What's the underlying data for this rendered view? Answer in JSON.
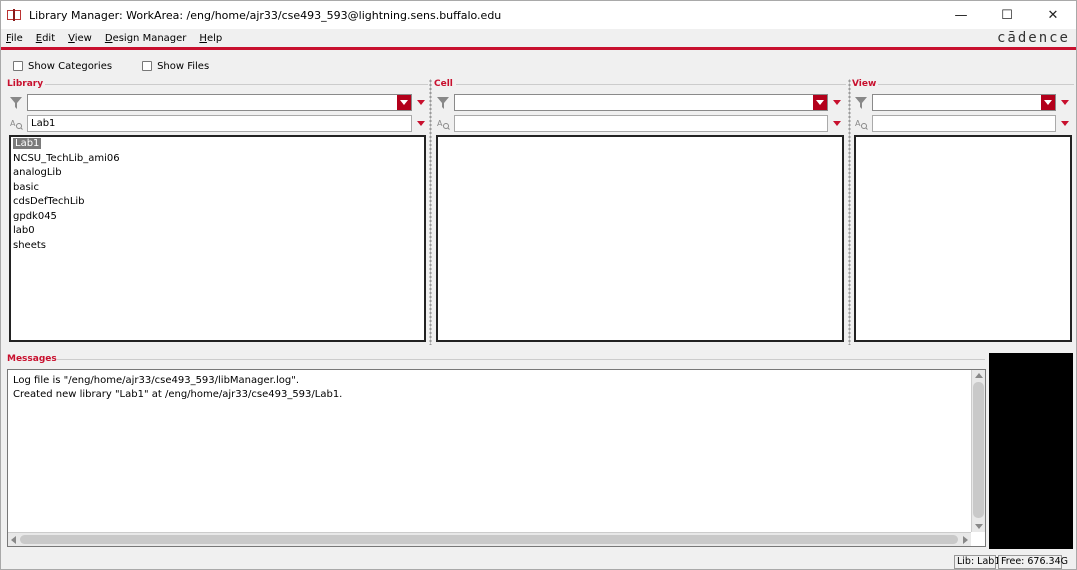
{
  "window": {
    "title": "Library Manager: WorkArea:  /eng/home/ajr33/cse493_593@lightning.sens.buffalo.edu",
    "minimize_glyph": "—",
    "maximize_glyph": "☐",
    "close_glyph": "✕"
  },
  "menu": {
    "items": [
      {
        "accel": "F",
        "rest": "ile"
      },
      {
        "accel": "E",
        "rest": "dit"
      },
      {
        "accel": "V",
        "rest": "iew"
      },
      {
        "accel": "D",
        "rest": "esign Manager"
      },
      {
        "accel": "H",
        "rest": "elp"
      }
    ],
    "brand": "cādence"
  },
  "toolbar": {
    "show_categories": "Show Categories",
    "show_files": "Show Files"
  },
  "library_pane": {
    "title": "Library",
    "filter_value": "",
    "current_value": "Lab1",
    "items": [
      "Lab1",
      "NCSU_TechLib_ami06",
      "analogLib",
      "basic",
      "cdsDefTechLib",
      "gpdk045",
      "lab0",
      "sheets"
    ],
    "selected_index": 0
  },
  "cell_pane": {
    "title": "Cell",
    "filter_value": "",
    "current_value": ""
  },
  "view_pane": {
    "title": "View",
    "filter_value": "",
    "current_value": ""
  },
  "messages": {
    "title": "Messages",
    "lines": [
      "Log file is \"/eng/home/ajr33/cse493_593/libManager.log\".",
      "Created new library \"Lab1\" at /eng/home/ajr33/cse493_593/Lab1."
    ]
  },
  "status": {
    "lib": "Lib: Lab1",
    "free": "Free: 676.34G"
  },
  "colors": {
    "accent_red": "#c8102e",
    "dropdown_red": "#b3001b",
    "selection_gray": "#7a7a7a"
  }
}
